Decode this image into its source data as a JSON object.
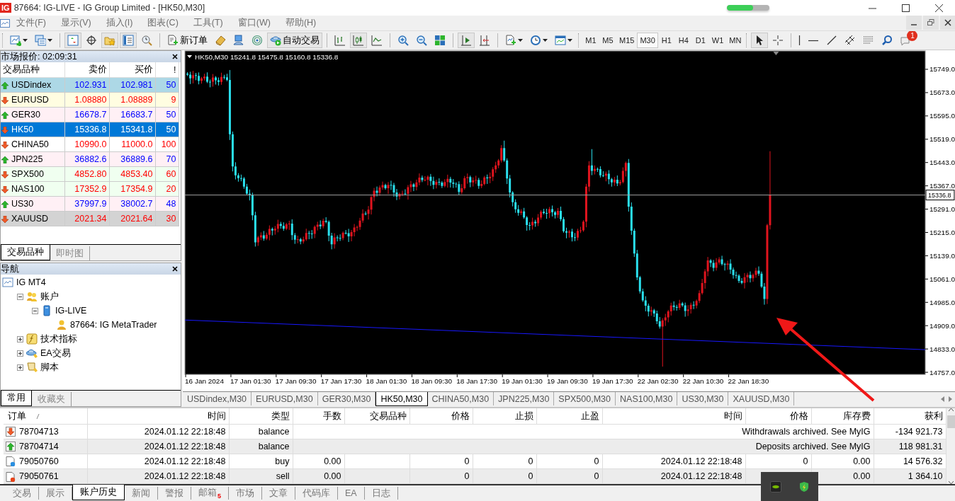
{
  "window": {
    "logo": "IG",
    "title": "87664: IG-LIVE - IG Group Limited - [HK50,M30]",
    "progress": {
      "level": 0.62
    }
  },
  "menu": [
    "文件(F)",
    "显示(V)",
    "插入(I)",
    "图表(C)",
    "工具(T)",
    "窗口(W)",
    "帮助(H)"
  ],
  "toolbar": {
    "groups": [
      [
        {
          "kind": "new-chart",
          "dropdown": true,
          "pressed": false
        },
        {
          "kind": "profiles",
          "dropdown": true,
          "pressed": false
        }
      ],
      [
        {
          "kind": "market-watch",
          "dropdown": false,
          "pressed": true
        },
        {
          "kind": "data-window",
          "dropdown": false,
          "pressed": false
        },
        {
          "kind": "navigator",
          "dropdown": false,
          "pressed": true
        },
        {
          "kind": "terminal",
          "dropdown": false,
          "pressed": true
        },
        {
          "kind": "tester",
          "dropdown": false,
          "pressed": false
        }
      ],
      [
        {
          "kind": "new-order",
          "label": "新订单",
          "dropdown": false,
          "pressed": false
        },
        {
          "kind": "editor",
          "dropdown": false,
          "pressed": false
        },
        {
          "kind": "vps",
          "dropdown": false,
          "pressed": false
        },
        {
          "kind": "signals",
          "dropdown": false,
          "pressed": false
        },
        {
          "kind": "autotrading",
          "label": "自动交易",
          "dropdown": false,
          "pressed": true
        }
      ],
      [
        {
          "kind": "bar-chart",
          "dropdown": false,
          "pressed": false
        },
        {
          "kind": "candles",
          "dropdown": false,
          "pressed": true
        },
        {
          "kind": "line-chart",
          "dropdown": false,
          "pressed": false
        }
      ],
      [
        {
          "kind": "zoom-in",
          "dropdown": false,
          "pressed": false
        },
        {
          "kind": "zoom-out",
          "dropdown": false,
          "pressed": false
        },
        {
          "kind": "tile",
          "dropdown": false,
          "pressed": false
        }
      ],
      [
        {
          "kind": "autoscroll",
          "dropdown": false,
          "pressed": true
        },
        {
          "kind": "chart-shift",
          "dropdown": false,
          "pressed": false
        }
      ],
      [
        {
          "kind": "indicators",
          "dropdown": true,
          "pressed": false
        },
        {
          "kind": "periods",
          "dropdown": true,
          "pressed": false
        },
        {
          "kind": "templates",
          "dropdown": true,
          "pressed": false
        }
      ]
    ],
    "timeframes": [
      {
        "label": "M1",
        "selected": false
      },
      {
        "label": "M5",
        "selected": false
      },
      {
        "label": "M15",
        "selected": false
      },
      {
        "label": "M30",
        "selected": true
      },
      {
        "label": "H1",
        "selected": false
      },
      {
        "label": "H4",
        "selected": false
      },
      {
        "label": "D1",
        "selected": false
      },
      {
        "label": "W1",
        "selected": false
      },
      {
        "label": "MN",
        "selected": false
      }
    ],
    "tools": [
      [
        {
          "kind": "cursor",
          "pressed": true
        },
        {
          "kind": "crosshair",
          "pressed": false
        }
      ],
      [
        {
          "kind": "vline",
          "pressed": false
        },
        {
          "kind": "hline",
          "pressed": false
        },
        {
          "kind": "trendline",
          "pressed": false
        },
        {
          "kind": "channel",
          "pressed": false
        },
        {
          "kind": "fibo",
          "pressed": false
        },
        {
          "kind": "search",
          "pressed": false
        },
        {
          "kind": "chat",
          "pressed": false,
          "badge": "1"
        }
      ]
    ]
  },
  "market_watch": {
    "title": "市场报价: 02:09:31",
    "columns": [
      "交易品种",
      "卖价",
      "买价",
      "!"
    ],
    "rows": [
      {
        "symbol": "USDindex",
        "bid": "102.931",
        "ask": "102.981",
        "spread": "50",
        "kind": "up",
        "selected": false,
        "color": "#add8e6"
      },
      {
        "symbol": "EURUSD",
        "bid": "1.08880",
        "ask": "1.08889",
        "spread": "9",
        "kind": "down",
        "selected": false,
        "color": "#fffde1"
      },
      {
        "symbol": "GER30",
        "bid": "16678.7",
        "ask": "16683.7",
        "spread": "50",
        "kind": "up",
        "selected": false,
        "color": "#fff0f5"
      },
      {
        "symbol": "HK50",
        "bid": "15336.8",
        "ask": "15341.8",
        "spread": "50",
        "kind": "down",
        "selected": true
      },
      {
        "symbol": "CHINA50",
        "bid": "10990.0",
        "ask": "11000.0",
        "spread": "100",
        "kind": "down",
        "selected": false,
        "color": "#ffffff"
      },
      {
        "symbol": "JPN225",
        "bid": "36882.6",
        "ask": "36889.6",
        "spread": "70",
        "kind": "up",
        "selected": false,
        "color": "#fff0f5"
      },
      {
        "symbol": "SPX500",
        "bid": "4852.80",
        "ask": "4853.40",
        "spread": "60",
        "kind": "down",
        "selected": false,
        "color": "#f0fff0"
      },
      {
        "symbol": "NAS100",
        "bid": "17352.9",
        "ask": "17354.9",
        "spread": "20",
        "kind": "down",
        "selected": false,
        "color": "#f0fff0"
      },
      {
        "symbol": "US30",
        "bid": "37997.9",
        "ask": "38002.7",
        "spread": "48",
        "kind": "up",
        "selected": false,
        "color": "#fff0f5"
      },
      {
        "symbol": "XAUUSD",
        "bid": "2021.34",
        "ask": "2021.64",
        "spread": "30",
        "kind": "down",
        "selected": false,
        "color": "#d3d3d3"
      }
    ],
    "tabs": [
      {
        "label": "交易品种",
        "selected": true
      },
      {
        "label": "即时图",
        "selected": false
      }
    ]
  },
  "navigator": {
    "title": "导航",
    "tree": [
      {
        "label": "IG MT4",
        "kind": "root",
        "children": [
          {
            "label": "账户",
            "kind": "accounts",
            "expanded": true,
            "children": [
              {
                "label": "IG-LIVE",
                "kind": "server",
                "expanded": true,
                "children": [
                  {
                    "label": "87664: IG MetaTrader",
                    "kind": "account"
                  }
                ]
              }
            ]
          },
          {
            "label": "技术指标",
            "kind": "indicators",
            "expanded": false
          },
          {
            "label": "EA交易",
            "kind": "experts",
            "expanded": false
          },
          {
            "label": "脚本",
            "kind": "scripts",
            "expanded": false
          }
        ]
      }
    ],
    "tabs": [
      {
        "label": "常用",
        "selected": true
      },
      {
        "label": "收藏夹",
        "selected": false
      }
    ]
  },
  "chart": {
    "symbol": "HK50,M30",
    "ohlc": "15241.8 15475.8 15160.8 15336.8",
    "current_price": "15336.8",
    "price_ticks": [
      "15749.0",
      "15673.0",
      "15595.0",
      "15519.0",
      "15443.0",
      "15367.0",
      "15291.0",
      "15215.0",
      "15139.0",
      "15061.0",
      "14985.0",
      "14909.0",
      "14833.0",
      "14757.0"
    ],
    "time_labels": [
      "16 Jan 2024",
      "17 Jan 01:30",
      "17 Jan 09:30",
      "17 Jan 17:30",
      "18 Jan 01:30",
      "18 Jan 09:30",
      "18 Jan 17:30",
      "19 Jan 01:30",
      "19 Jan 09:30",
      "19 Jan 17:30",
      "22 Jan 02:30",
      "22 Jan 10:30",
      "22 Jan 18:30"
    ],
    "tabs": [
      {
        "label": "USDindex,M30",
        "selected": false
      },
      {
        "label": "EURUSD,M30",
        "selected": false
      },
      {
        "label": "GER30,M30",
        "selected": false
      },
      {
        "label": "HK50,M30",
        "selected": true
      },
      {
        "label": "CHINA50,M30",
        "selected": false
      },
      {
        "label": "JPN225,M30",
        "selected": false
      },
      {
        "label": "SPX500,M30",
        "selected": false
      },
      {
        "label": "NAS100,M30",
        "selected": false
      },
      {
        "label": "US30,M30",
        "selected": false
      },
      {
        "label": "XAUUSD,M30",
        "selected": false
      }
    ]
  },
  "terminal": {
    "columns": [
      "订单",
      "时间",
      "类型",
      "手数",
      "交易品种",
      "价格",
      "止损",
      "止盈",
      "时间",
      "价格",
      "库存费",
      "获利"
    ],
    "rows": [
      {
        "kind": "withdrawal",
        "order": "78704713",
        "time": "2024.01.12 22:18:48",
        "type": "balance",
        "comment": "Withdrawals archived. See MyIG",
        "profit": "-134 921.73"
      },
      {
        "kind": "deposit",
        "order": "78704714",
        "time": "2024.01.12 22:18:48",
        "type": "balance",
        "comment": "Deposits archived. See MyIG",
        "profit": "118 981.31"
      },
      {
        "kind": "buy",
        "order": "79050760",
        "time": "2024.01.12 22:18:48",
        "type": "buy",
        "lots": "0.00",
        "price": "0",
        "sl": "0",
        "tp": "0",
        "close_time": "2024.01.12 22:18:48",
        "close_price": "0",
        "swap": "0.00",
        "profit": "14 576.32"
      },
      {
        "kind": "sell",
        "order": "79050761",
        "time": "2024.01.12 22:18:48",
        "type": "sell",
        "lots": "0.00",
        "price": "0",
        "sl": "0",
        "tp": "0",
        "close_time": "2024.01.12 22:18:48",
        "swap": "0.00",
        "profit": "1 364.10"
      }
    ],
    "tabs": [
      {
        "label": "交易",
        "selected": false
      },
      {
        "label": "展示",
        "selected": false
      },
      {
        "label": "账户历史",
        "selected": true
      },
      {
        "label": "新闻",
        "selected": false
      },
      {
        "label": "警报",
        "selected": false
      },
      {
        "label": "邮箱",
        "selected": false,
        "badge": "5"
      },
      {
        "label": "市场",
        "selected": false
      },
      {
        "label": "文章",
        "selected": false
      },
      {
        "label": "代码库",
        "selected": false
      },
      {
        "label": "EA",
        "selected": false
      },
      {
        "label": "日志",
        "selected": false
      }
    ]
  }
}
